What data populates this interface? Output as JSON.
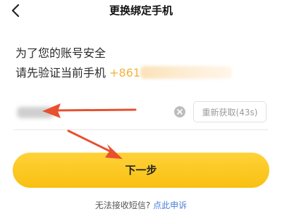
{
  "header": {
    "back_icon": "chevron-left-icon",
    "title": "更换绑定手机"
  },
  "intro": {
    "line1": "为了您的账号安全",
    "line2": "请先验证当前手机",
    "phone_prefix": "+861"
  },
  "verification": {
    "resend_label": "重新获取(43s)",
    "clear_icon": "clear-circle-icon"
  },
  "actions": {
    "next_label": "下一步"
  },
  "footer": {
    "question": "无法接收短信?",
    "link": "点此申诉"
  },
  "colors": {
    "accent_yellow": "#f8c010",
    "phone_orange": "#f6b23b",
    "link_blue": "#4a7fd8",
    "arrow_red": "#e8502e"
  }
}
